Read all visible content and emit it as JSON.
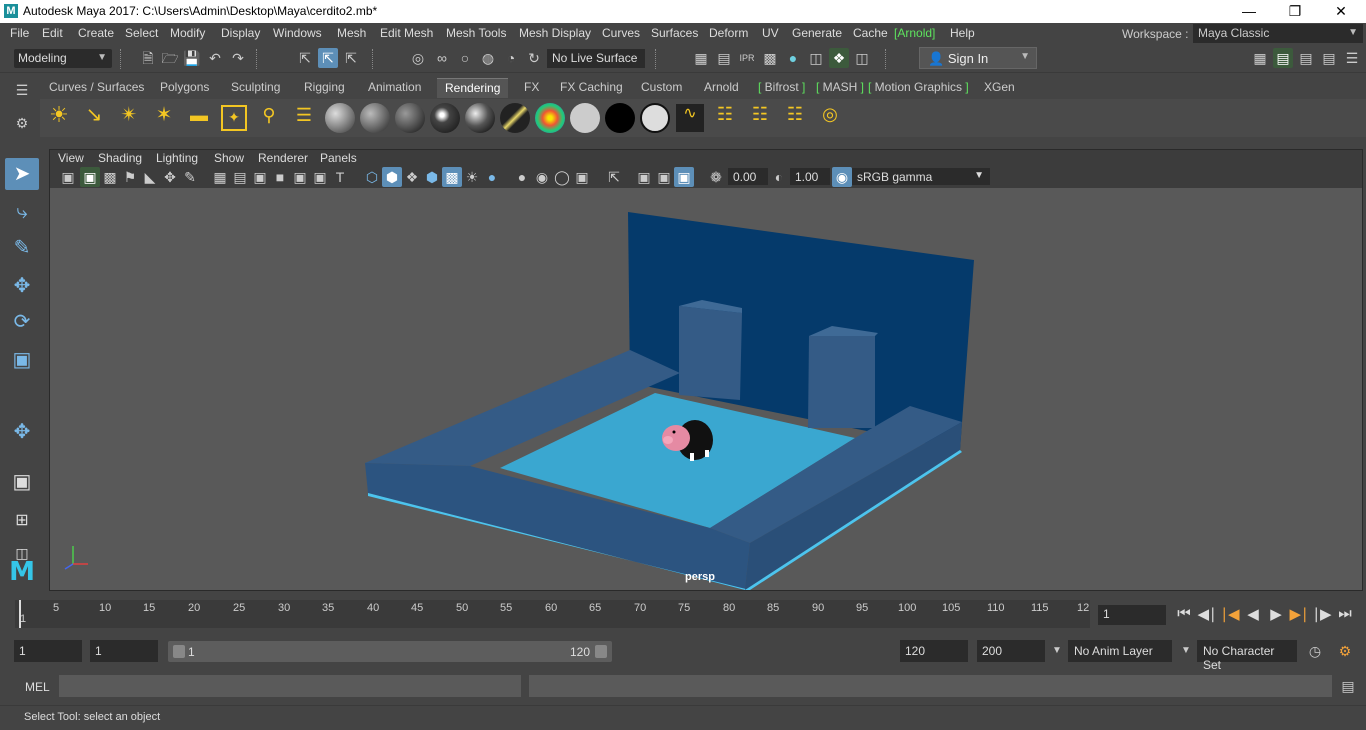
{
  "window": {
    "title": "Autodesk Maya 2017: C:\\Users\\Admin\\Desktop\\Maya\\cerdito2.mb*",
    "app_icon": "M"
  },
  "menubar": {
    "items": [
      "File",
      "Edit",
      "Create",
      "Select",
      "Modify",
      "Display",
      "Windows",
      "Mesh",
      "Edit Mesh",
      "Mesh Tools",
      "Mesh Display",
      "Curves",
      "Surfaces",
      "Deform",
      "UV",
      "Generate",
      "Cache"
    ],
    "arnold": "Arnold",
    "help": "Help",
    "workspace_label": "Workspace :",
    "workspace_value": "Maya Classic"
  },
  "statusline": {
    "menuset": "Modeling",
    "live_surface": "No Live Surface",
    "sign_in": "Sign In"
  },
  "shelf": {
    "tabs": [
      "Curves / Surfaces",
      "Polygons",
      "Sculpting",
      "Rigging",
      "Animation",
      "Rendering",
      "FX",
      "FX Caching",
      "Custom",
      "Arnold",
      "Bifrost",
      "MASH",
      "Motion Graphics",
      "XGen"
    ],
    "active_tab": "Rendering"
  },
  "panel": {
    "menus": [
      "View",
      "Shading",
      "Lighting",
      "Show",
      "Renderer",
      "Panels"
    ],
    "exposure": "0.00",
    "gamma": "1.00",
    "color_space": "sRGB gamma",
    "camera_label": "persp"
  },
  "timeline": {
    "ticks": [
      "1",
      "5",
      "10",
      "15",
      "20",
      "25",
      "30",
      "35",
      "40",
      "45",
      "50",
      "55",
      "60",
      "65",
      "70",
      "75",
      "80",
      "85",
      "90",
      "95",
      "100",
      "105",
      "110",
      "115",
      "12"
    ],
    "current_frame": "1"
  },
  "range": {
    "start": "1",
    "playback_start": "1",
    "slider_start": "1",
    "slider_end": "120",
    "playback_end": "120",
    "end": "200",
    "anim_layer": "No Anim Layer",
    "character_set": "No Character Set"
  },
  "commandline": {
    "language": "MEL"
  },
  "helpline": {
    "text": "Select Tool: select an object"
  },
  "colors": {
    "accent": "#5d8fb8",
    "arnold_green": "#5ee35e",
    "backdrop": "#053a6b",
    "floor": "#3aa7d0",
    "wall": "#345b86"
  }
}
